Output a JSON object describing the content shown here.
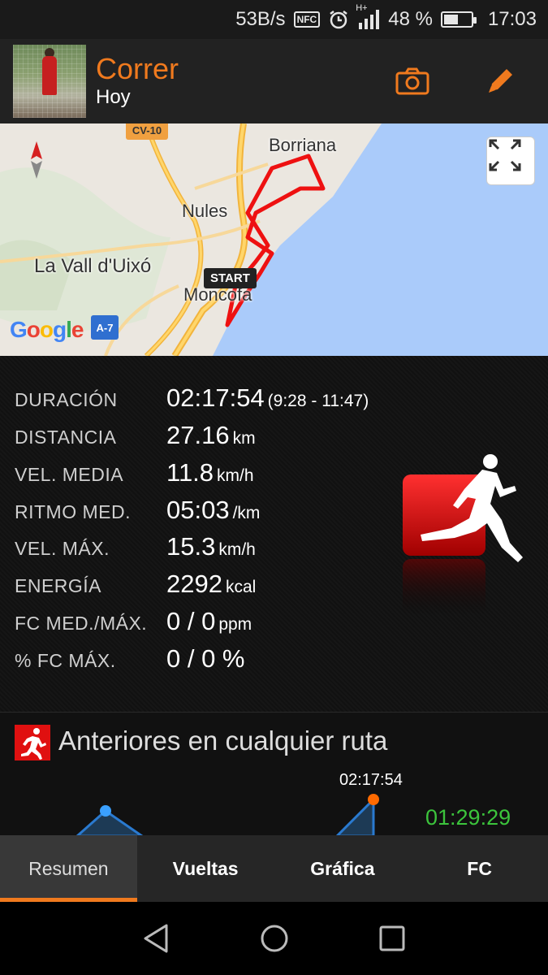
{
  "status_bar": {
    "speed": "53B/s",
    "nfc": "NFC",
    "network": "H+",
    "battery_percent": "48 %",
    "battery_level": 0.48,
    "time": "17:03"
  },
  "header": {
    "title": "Correr",
    "subtitle": "Hoy"
  },
  "map": {
    "places": [
      "Borriana",
      "Nules",
      "La Vall d'Uixó",
      "Moncofa"
    ],
    "road_top": "CV-10",
    "road_bottom": "A-7",
    "start_label": "START",
    "provider": "Google"
  },
  "stats": [
    {
      "label": "DURACIÓN",
      "value": "02:17:54",
      "unit": "(9:28 - 11:47)"
    },
    {
      "label": "DISTANCIA",
      "value": "27.16",
      "unit": "km"
    },
    {
      "label": "VEL. MEDIA",
      "value": "11.8",
      "unit": "km/h"
    },
    {
      "label": "RITMO MED.",
      "value": "05:03",
      "unit": "/km"
    },
    {
      "label": "VEL. MÁX.",
      "value": "15.3",
      "unit": "km/h"
    },
    {
      "label": "ENERGÍA",
      "value": "2292",
      "unit": "kcal"
    },
    {
      "label": "FC MED./MÁX.",
      "value": "0 / 0",
      "unit": "ppm"
    },
    {
      "label": "% FC MÁX.",
      "value": "0 / 0 %",
      "unit": ""
    }
  ],
  "previous": {
    "title": "Anteriores en cualquier ruta",
    "peak_time": "02:17:54",
    "other_time": "01:29:29"
  },
  "tabs": [
    {
      "label": "Resumen",
      "active": true
    },
    {
      "label": "Vueltas",
      "active": false
    },
    {
      "label": "Gráfica",
      "active": false
    },
    {
      "label": "FC",
      "active": false
    }
  ],
  "colors": {
    "accent": "#f07a1e",
    "route": "#ee1111",
    "green": "#3cc43c"
  }
}
